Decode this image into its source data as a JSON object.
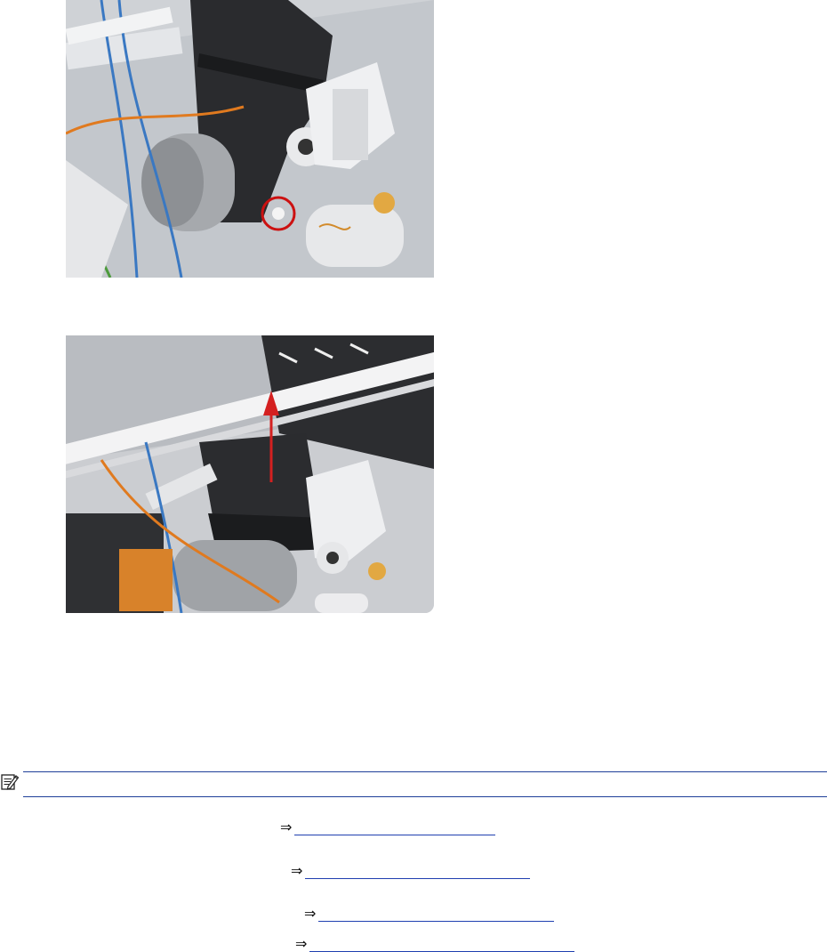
{
  "figures": [
    {
      "id": "figure-1",
      "callout": "screw-circled"
    },
    {
      "id": "figure-2",
      "callout": "lift-up-arrow"
    }
  ],
  "callout_colors": {
    "circle": "#cc1111",
    "arrow": "#d42020"
  },
  "note": {
    "icon": "note-pencil-icon",
    "rule_color": "#1f3f99"
  },
  "cross_references": [
    {
      "arrow": "⇒",
      "text": ""
    },
    {
      "arrow": "⇒",
      "text": ""
    },
    {
      "arrow": "⇒",
      "text": ""
    },
    {
      "arrow": "⇒",
      "text": ""
    }
  ],
  "colors": {
    "link": "#1f3fb0",
    "rule": "#1f3f99"
  }
}
